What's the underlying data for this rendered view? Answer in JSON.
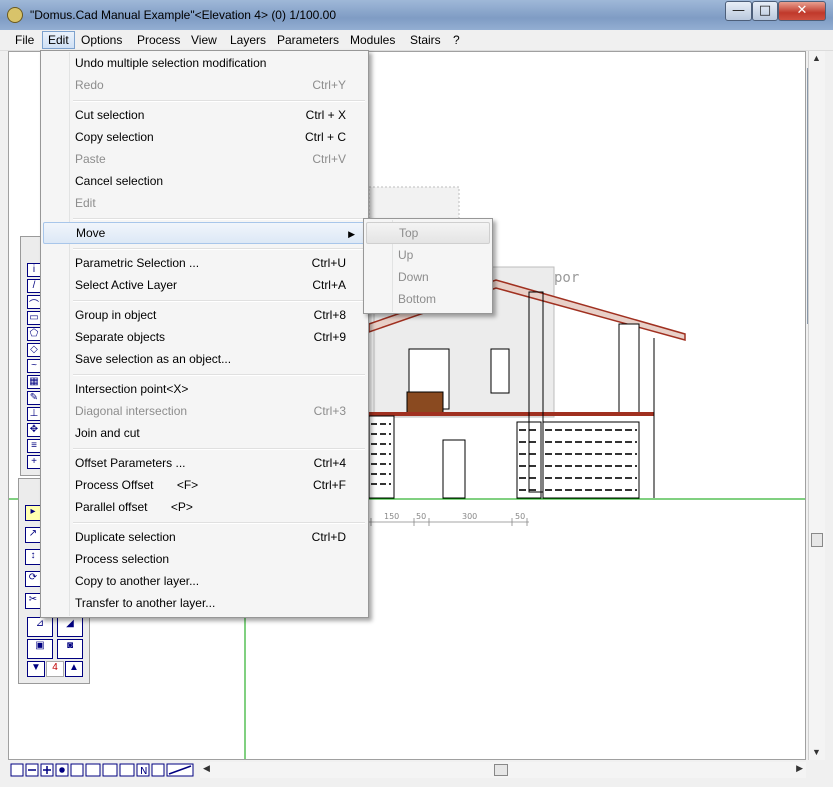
{
  "window": {
    "title": "\"Domus.Cad Manual Example\"<Elevation 4> (0) 1/100.00",
    "icon": "app-icon",
    "controls": {
      "minimize": "—",
      "maximize": "□",
      "close": "✕"
    }
  },
  "menubar": {
    "items": [
      "File",
      "Edit",
      "Options",
      "Process",
      "View",
      "Layers",
      "Parameters",
      "Modules",
      "Stairs",
      "?"
    ],
    "active": "Edit"
  },
  "edit_menu": {
    "items": [
      {
        "label": "Undo multiple selection modification",
        "shortcut": "",
        "disabled": false
      },
      {
        "label": "Redo",
        "shortcut": "Ctrl+Y",
        "disabled": true
      },
      {
        "label": "Cut selection",
        "shortcut": "Ctrl + X",
        "disabled": false
      },
      {
        "label": "Copy selection",
        "shortcut": "Ctrl + C",
        "disabled": false
      },
      {
        "label": "Paste",
        "shortcut": "Ctrl+V",
        "disabled": true
      },
      {
        "label": "Cancel selection",
        "shortcut": "",
        "disabled": false
      },
      {
        "label": "Edit",
        "shortcut": "",
        "disabled": true
      },
      {
        "label": "Move",
        "shortcut": "",
        "disabled": false,
        "submenu": true
      },
      {
        "label": "Parametric Selection ...",
        "shortcut": "Ctrl+U",
        "disabled": false
      },
      {
        "label": "Select Active Layer",
        "shortcut": "Ctrl+A",
        "disabled": false
      },
      {
        "label": "Group in object",
        "shortcut": "Ctrl+8",
        "disabled": false
      },
      {
        "label": "Separate objects",
        "shortcut": "Ctrl+9",
        "disabled": false
      },
      {
        "label": "Save selection as an object...",
        "shortcut": "",
        "disabled": false
      },
      {
        "label": "Intersection point<X>",
        "shortcut": "",
        "disabled": false
      },
      {
        "label": "Diagonal intersection",
        "shortcut": "Ctrl+3",
        "disabled": true
      },
      {
        "label": "Join and cut",
        "shortcut": "",
        "disabled": false
      },
      {
        "label": "Offset Parameters ...",
        "shortcut": "Ctrl+4",
        "disabled": false
      },
      {
        "label": "Process Offset       <F>",
        "shortcut": "Ctrl+F",
        "disabled": false
      },
      {
        "label": "Parallel offset       <P>",
        "shortcut": "",
        "disabled": false
      },
      {
        "label": "Duplicate selection",
        "shortcut": "Ctrl+D",
        "disabled": false
      },
      {
        "label": "Process selection",
        "shortcut": "",
        "disabled": false
      },
      {
        "label": "Copy to another layer...",
        "shortcut": "",
        "disabled": false
      },
      {
        "label": "Transfer to another layer...",
        "shortcut": "",
        "disabled": false
      }
    ]
  },
  "move_submenu": {
    "items": [
      "Top",
      "Up",
      "Down",
      "Bottom"
    ]
  },
  "drawing": {
    "dimensions": [
      "150",
      "50",
      "300",
      "50"
    ],
    "watermark": "por"
  },
  "palette": {
    "counter": "4"
  },
  "statusbar": {
    "tools": [
      "home-icon",
      "minus-icon",
      "plus-icon",
      "dot-icon",
      "arrows-icon",
      "grid-icon",
      "hand-icon",
      "n-icon",
      "ruler-icon"
    ]
  },
  "colors": {
    "accent": "#1a3d8f",
    "grid_line": "#00a000",
    "roof": "#a03020"
  }
}
